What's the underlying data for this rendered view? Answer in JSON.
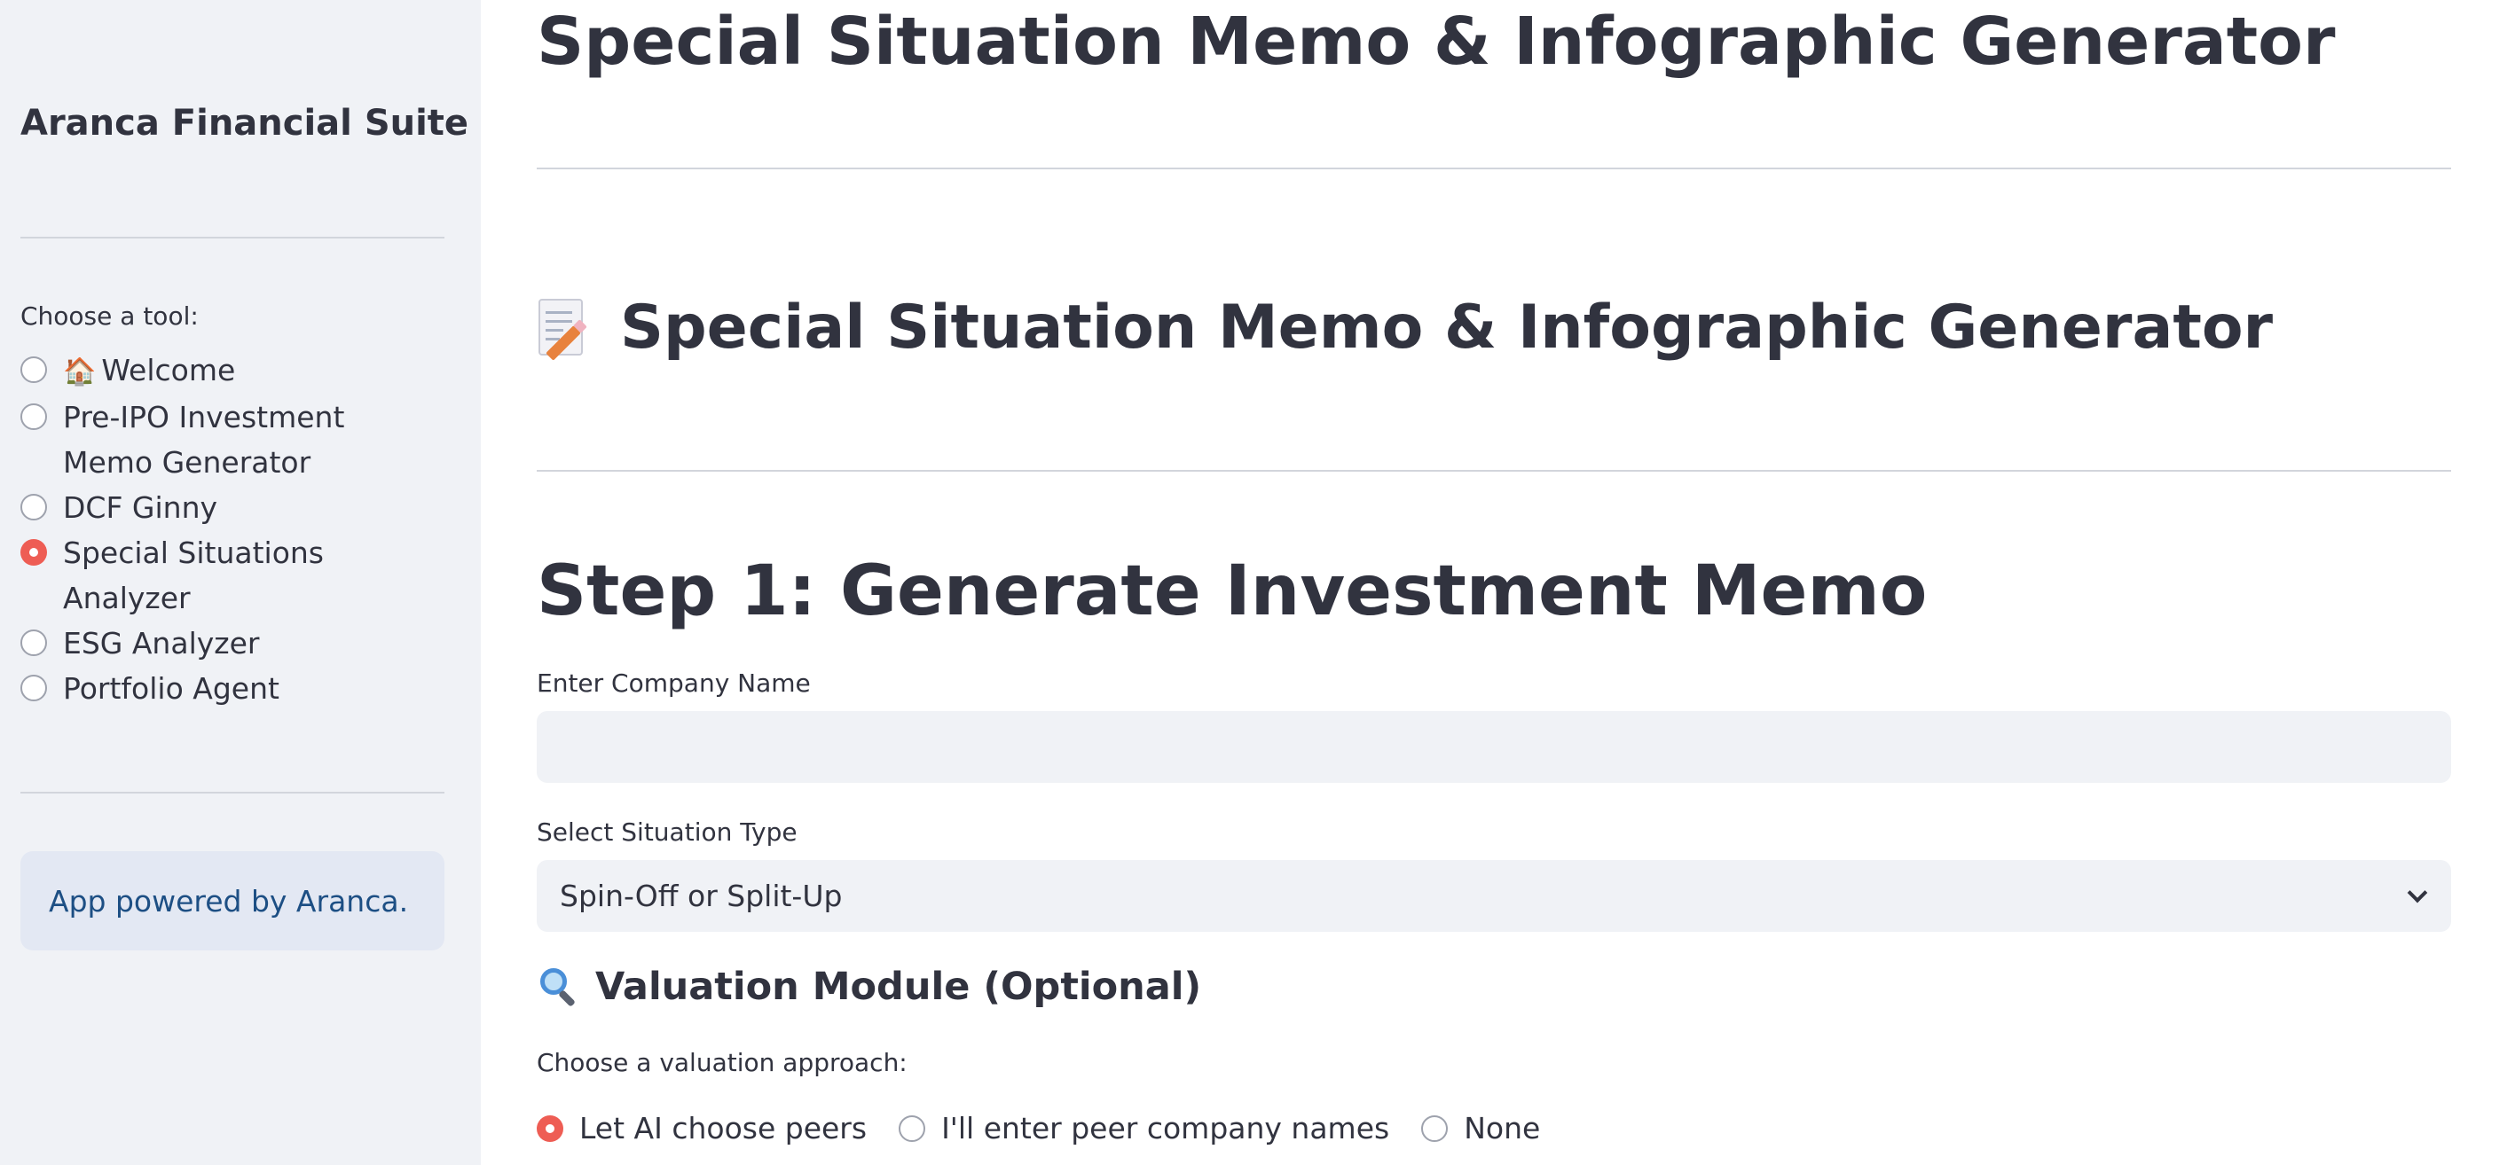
{
  "sidebar": {
    "title": "Aranca Financial Suite",
    "choose_label": "Choose a tool:",
    "items": [
      {
        "label": "Welcome",
        "selected": false,
        "icon": "house-icon"
      },
      {
        "label": "Pre-IPO Investment Memo Generator",
        "selected": false
      },
      {
        "label": "DCF Ginny",
        "selected": false
      },
      {
        "label": "Special Situations Analyzer",
        "selected": true
      },
      {
        "label": "ESG Analyzer",
        "selected": false
      },
      {
        "label": "Portfolio Agent",
        "selected": false
      }
    ],
    "info": "App powered by Aranca."
  },
  "main": {
    "page_title": "Special Situation Memo & Infographic Generator",
    "memo_heading": "Special Situation Memo & Infographic Generator",
    "memo_icon": "memo-icon",
    "step_heading": "Step 1: Generate Investment Memo",
    "company_label": "Enter Company Name",
    "company_value": "",
    "situation_label": "Select Situation Type",
    "situation_value": "Spin-Off or Split-Up",
    "valuation_heading": "Valuation Module (Optional)",
    "valuation_icon": "magnifying-glass-icon",
    "approach_label": "Choose a valuation approach:",
    "approach_options": [
      {
        "label": "Let AI choose peers",
        "selected": true
      },
      {
        "label": "I'll enter peer company names",
        "selected": false
      },
      {
        "label": "None",
        "selected": false
      }
    ]
  },
  "colors": {
    "accent": "#ee5d54",
    "sidebar_bg": "#f0f2f6",
    "info_bg": "#e3e8f3",
    "info_text": "#1d4f84",
    "text": "#31333f"
  }
}
